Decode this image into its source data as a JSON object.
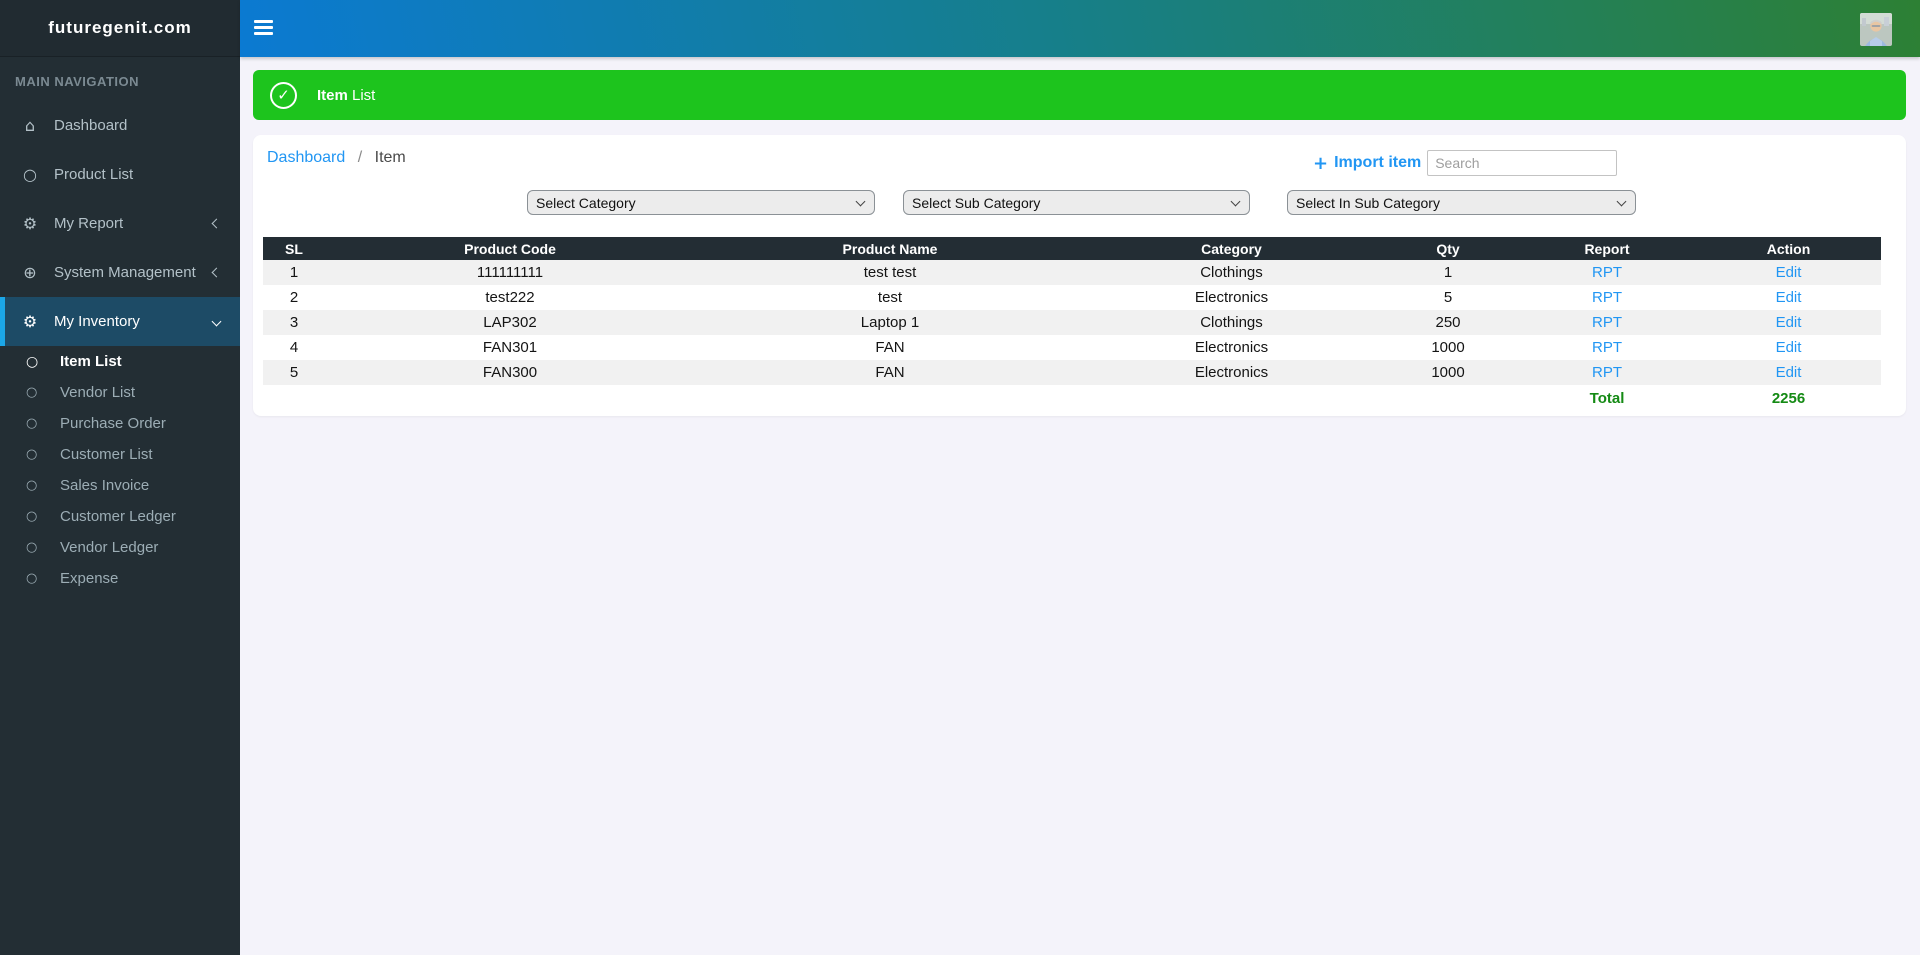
{
  "brand": "futuregenit.com",
  "sidebar": {
    "section_label": "MAIN NAVIGATION",
    "items": [
      {
        "label": "Dashboard",
        "icon": "home-icon"
      },
      {
        "label": "Product List",
        "icon": "circle-icon"
      },
      {
        "label": "My Report",
        "icon": "gear-icon",
        "chevron": "left"
      },
      {
        "label": "System Management",
        "icon": "circle-plus-icon",
        "chevron": "left"
      },
      {
        "label": "My Inventory",
        "icon": "gear-icon",
        "chevron": "down",
        "active": true
      }
    ],
    "submenu": {
      "active": "Item List",
      "items": [
        {
          "label": "Item List"
        },
        {
          "label": "Vendor List"
        },
        {
          "label": "Purchase Order"
        },
        {
          "label": "Customer List"
        },
        {
          "label": "Sales Invoice"
        },
        {
          "label": "Customer Ledger"
        },
        {
          "label": "Vendor Ledger"
        },
        {
          "label": "Expense"
        }
      ]
    }
  },
  "banner": {
    "title_bold": "Item",
    "title_rest": " List"
  },
  "breadcrumb": {
    "link": "Dashboard",
    "separator": "/",
    "current": "Item"
  },
  "toolbar": {
    "import_label": "Import item",
    "search_placeholder": "Search"
  },
  "filters": {
    "category": "Select Category",
    "sub_category": "Select Sub Category",
    "in_sub_category": "Select In Sub Category"
  },
  "table": {
    "columns": [
      "SL",
      "Product Code",
      "Product Name",
      "Category",
      "Qty",
      "Report",
      "Action"
    ],
    "rows": [
      [
        "1",
        "111111111",
        "test test",
        "Clothings",
        "1",
        "RPT",
        "Edit"
      ],
      [
        "2",
        "test222",
        "test",
        "Electronics",
        "5",
        "RPT",
        "Edit"
      ],
      [
        "3",
        "LAP302",
        "Laptop 1",
        "Clothings",
        "250",
        "RPT",
        "Edit"
      ],
      [
        "4",
        "FAN301",
        "FAN",
        "Electronics",
        "1000",
        "RPT",
        "Edit"
      ],
      [
        "5",
        "FAN300",
        "FAN",
        "Electronics",
        "1000",
        "RPT",
        "Edit"
      ]
    ],
    "total_label": "Total",
    "total_value": "2256"
  },
  "icons": {
    "home": "⌂",
    "gear": "⚙",
    "circle_plus": "⊕",
    "circle": "○",
    "check": "✓",
    "plus": "+"
  },
  "colors": {
    "banner_green": "#1dc41d",
    "link_blue": "#2196f3",
    "total_green": "#148a14",
    "sidebar_bg": "#232e34",
    "active_item_bg": "#1d4b66",
    "active_item_border": "#1ba7e8",
    "table_header_bg": "#232d34",
    "topbar_gradient_start": "#0b7ad2",
    "topbar_gradient_end": "#2d8034",
    "page_bg": "#f4f3fa"
  }
}
